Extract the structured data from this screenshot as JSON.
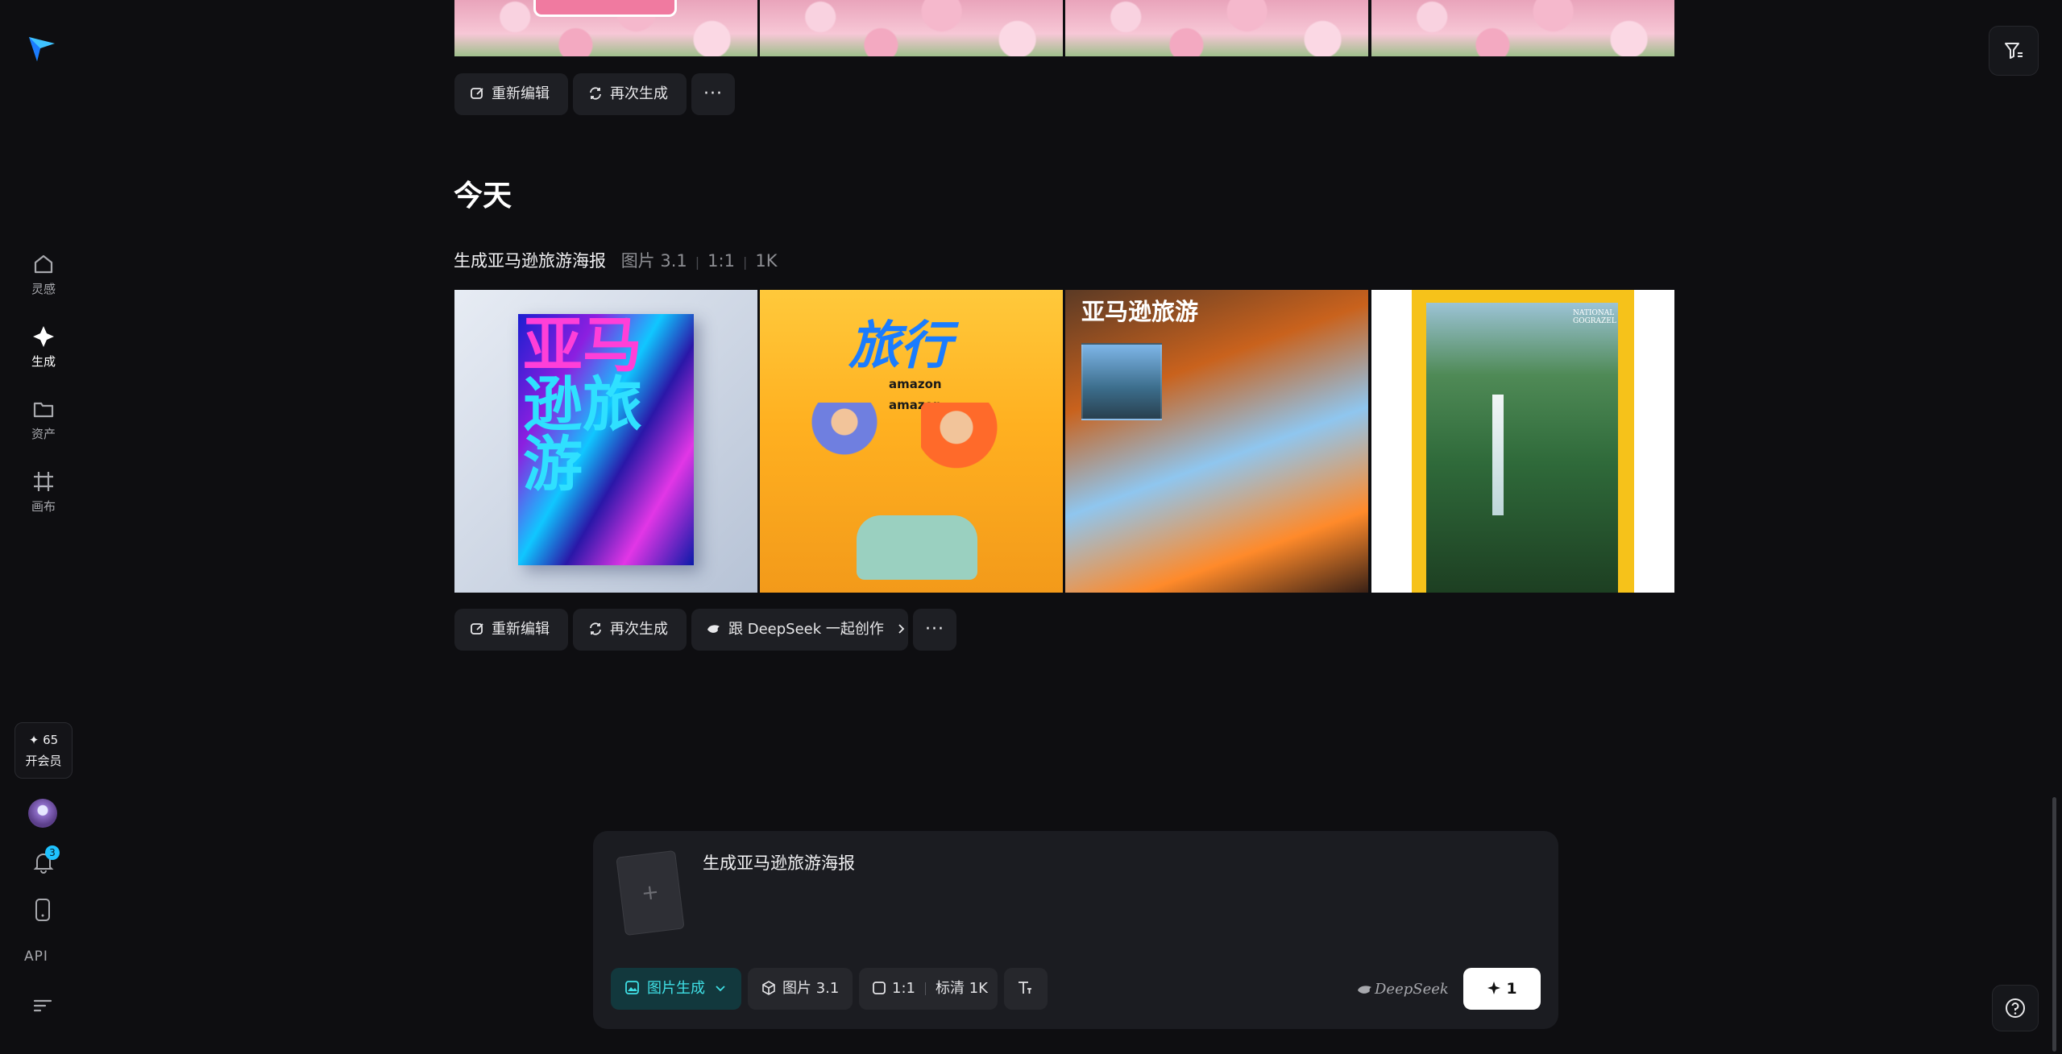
{
  "sidebar": {
    "items": [
      {
        "label": "灵感",
        "icon": "home-icon",
        "active": false
      },
      {
        "label": "生成",
        "icon": "sparkle-icon",
        "active": true
      },
      {
        "label": "资产",
        "icon": "folder-icon",
        "active": false
      },
      {
        "label": "画布",
        "icon": "canvas-icon",
        "active": false
      }
    ],
    "points": "✦ 65",
    "join_label": "开会员",
    "notification_count": "3",
    "api_label": "API"
  },
  "previous_group": {
    "buttons": {
      "reedit": "重新编辑",
      "regenerate": "再次生成",
      "more": "···"
    }
  },
  "today": {
    "title": "今天",
    "prompt": "生成亚马逊旅游海报",
    "tags": [
      "图片 3.1",
      "1:1",
      "1K"
    ],
    "images": [
      {
        "name": "poster-1",
        "text_line1": "亚马",
        "text_line2": "逊旅游"
      },
      {
        "name": "poster-2",
        "text": "旅行",
        "brand1": "amazon",
        "brand2": "amazon"
      },
      {
        "name": "poster-3",
        "text": "亚马逊旅游"
      },
      {
        "name": "poster-4",
        "text": "NATIONAL GOGRAZEL"
      }
    ],
    "buttons": {
      "reedit": "重新编辑",
      "regenerate": "再次生成",
      "deepseek": "跟 DeepSeek 一起创作",
      "more": "···"
    }
  },
  "composer": {
    "prompt": "生成亚马逊旅游海报",
    "upload_symbol": "+",
    "mode": "图片生成",
    "model": "图片 3.1",
    "ratio": "1:1",
    "quality": "标清 1K",
    "deepseek_label": "DeepSeek",
    "generate_cost": "1"
  },
  "colors": {
    "accent": "#3fe0e6",
    "badge": "#1fc2ff",
    "background": "#0e0e11"
  }
}
